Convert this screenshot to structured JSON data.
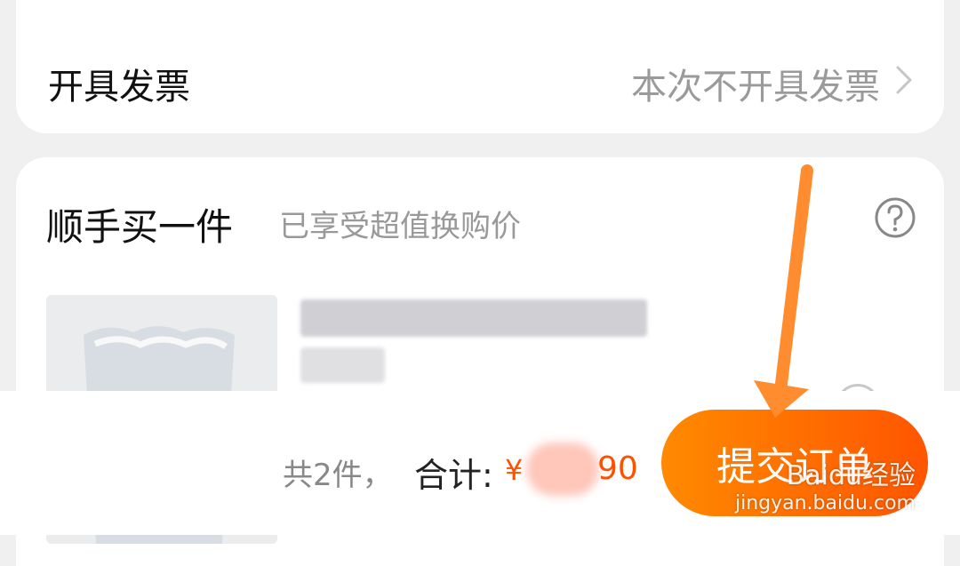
{
  "invoice": {
    "label": "开具发票",
    "value": "本次不开具发票"
  },
  "addon": {
    "title": "顺手买一件",
    "subtitle": "已享受超值换购价"
  },
  "order": {
    "item_count": "共2件，",
    "total_label": "合计:",
    "currency": "¥",
    "price_visible_suffix": "90",
    "submit_label": "提交订单"
  },
  "watermark": {
    "logo": "Baidu经验",
    "url": "jingyan.baidu.com"
  },
  "colors": {
    "accent": "#ff5000",
    "button_start": "#ff8a00",
    "arrow": "#ff8c2f"
  },
  "icons": [
    "chevron-right-icon",
    "help-icon",
    "select-circle-icon"
  ]
}
